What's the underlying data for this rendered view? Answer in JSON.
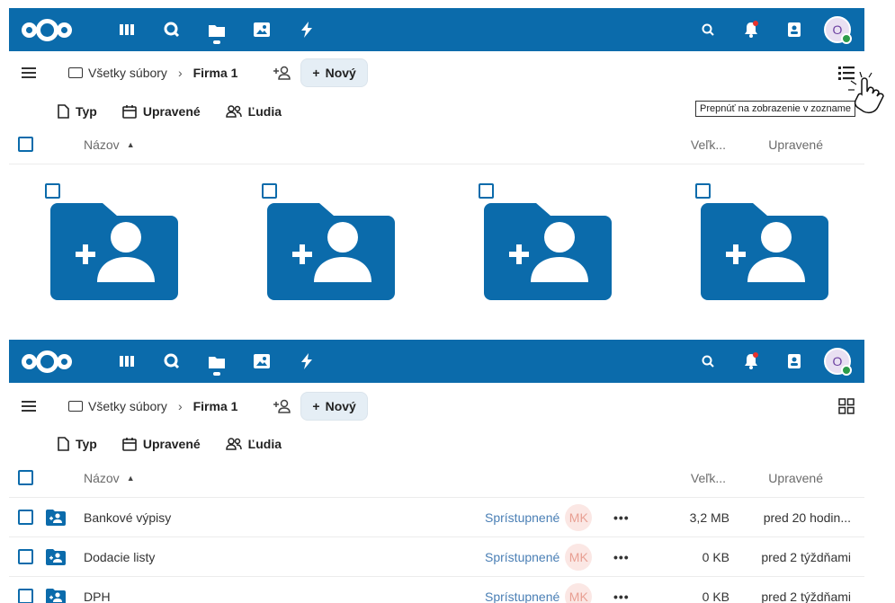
{
  "header": {
    "apps": [
      "dashboard",
      "search",
      "files",
      "photos",
      "activity"
    ],
    "avatar_initial": "O"
  },
  "breadcrumb": {
    "root": "Všetky súbory",
    "current": "Firma 1"
  },
  "toolbar": {
    "new_label": "Nový"
  },
  "filters": {
    "type": "Typ",
    "modified": "Upravené",
    "people": "Ľudia"
  },
  "table": {
    "col_name": "Názov",
    "col_size": "Veľk...",
    "col_modified": "Upravené"
  },
  "tooltip": {
    "list_view": "Prepnúť na zobrazenie v zozname"
  },
  "rows": [
    {
      "name": "Bankové výpisy",
      "shared": "Sprístupnené",
      "initials": "MK",
      "size": "3,2 MB",
      "modified": "pred 20 hodin..."
    },
    {
      "name": "Dodacie listy",
      "shared": "Sprístupnené",
      "initials": "MK",
      "size": "0 KB",
      "modified": "pred 2 týždňami"
    },
    {
      "name": "DPH",
      "shared": "Sprístupnené",
      "initials": "MK",
      "size": "0 KB",
      "modified": "pred 2 týždňami"
    }
  ],
  "colors": {
    "brand": "#0b6bab"
  }
}
